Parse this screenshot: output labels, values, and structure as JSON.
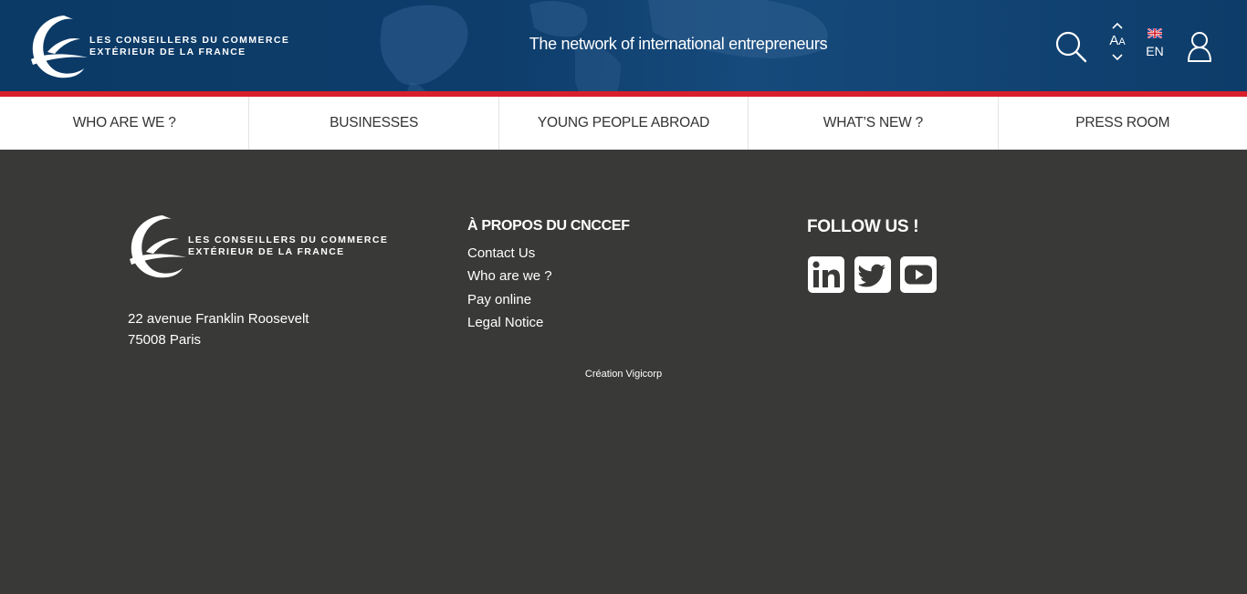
{
  "header": {
    "logo": {
      "line1": "LES CONSEILLERS DU COMMERCE",
      "line2": "EXTÉRIEUR DE LA FRANCE"
    },
    "tagline": "The network of international entrepreneurs",
    "search_icon": "search-icon",
    "font_size": {
      "big": "A",
      "small": "A",
      "up_icon": "chevron-up-icon",
      "down_icon": "chevron-down-icon"
    },
    "language": {
      "code": "EN",
      "flag_icon": "uk-flag-icon"
    },
    "user_icon": "user-icon"
  },
  "nav": {
    "items": [
      {
        "label": "WHO ARE WE ?"
      },
      {
        "label": "BUSINESSES"
      },
      {
        "label": "YOUNG PEOPLE ABROAD"
      },
      {
        "label": "WHAT’S NEW ?"
      },
      {
        "label": "PRESS ROOM"
      }
    ]
  },
  "footer": {
    "logo": {
      "line1": "LES CONSEILLERS DU COMMERCE",
      "line2": "EXTÉRIEUR DE LA FRANCE"
    },
    "address": {
      "line1": "22 avenue Franklin Roosevelt",
      "line2": "75008 Paris"
    },
    "about": {
      "title": "À PROPOS DU CNCCEF",
      "links": [
        "Contact Us",
        "Who are we ?",
        "Pay online",
        "Legal Notice"
      ]
    },
    "follow": {
      "title": "FOLLOW US !",
      "socials": [
        "linkedin-icon",
        "twitter-icon",
        "youtube-icon"
      ]
    },
    "credit": "Création Vigicorp"
  },
  "colors": {
    "header_bg": "#0e3d6b",
    "accent_red": "#d81e2c",
    "footer_bg": "#393a37",
    "nav_bg": "#ffffff",
    "nav_text": "#333333"
  }
}
